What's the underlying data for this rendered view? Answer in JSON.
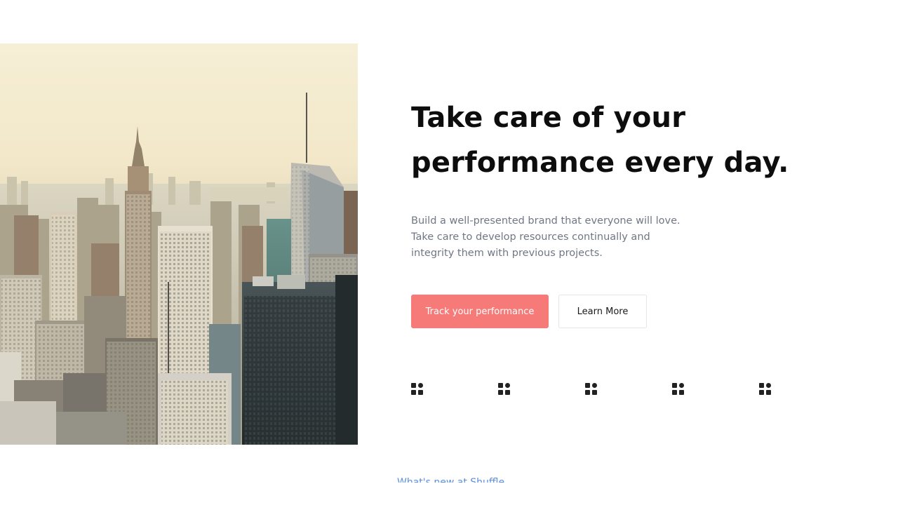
{
  "hero": {
    "headline_line1": "Take care of your",
    "headline_line2": "performance every day.",
    "description": "Build a well-presented brand that everyone will love. Take care to develop resources continually and integrity them with previous projects.",
    "primary_button_label": "Track your performance",
    "secondary_button_label": "Learn More",
    "image": "city-skyline-photo"
  },
  "logos": [
    {
      "icon": "shuffle-logo-icon"
    },
    {
      "icon": "shuffle-logo-icon"
    },
    {
      "icon": "shuffle-logo-icon"
    },
    {
      "icon": "shuffle-logo-icon"
    },
    {
      "icon": "shuffle-logo-icon"
    }
  ],
  "next_section": {
    "link_text": "What's new at Shuffle"
  },
  "colors": {
    "accent": "#f57a78",
    "heading": "#0d0d0d",
    "body_text": "#707784",
    "link": "#5b8fe0"
  }
}
